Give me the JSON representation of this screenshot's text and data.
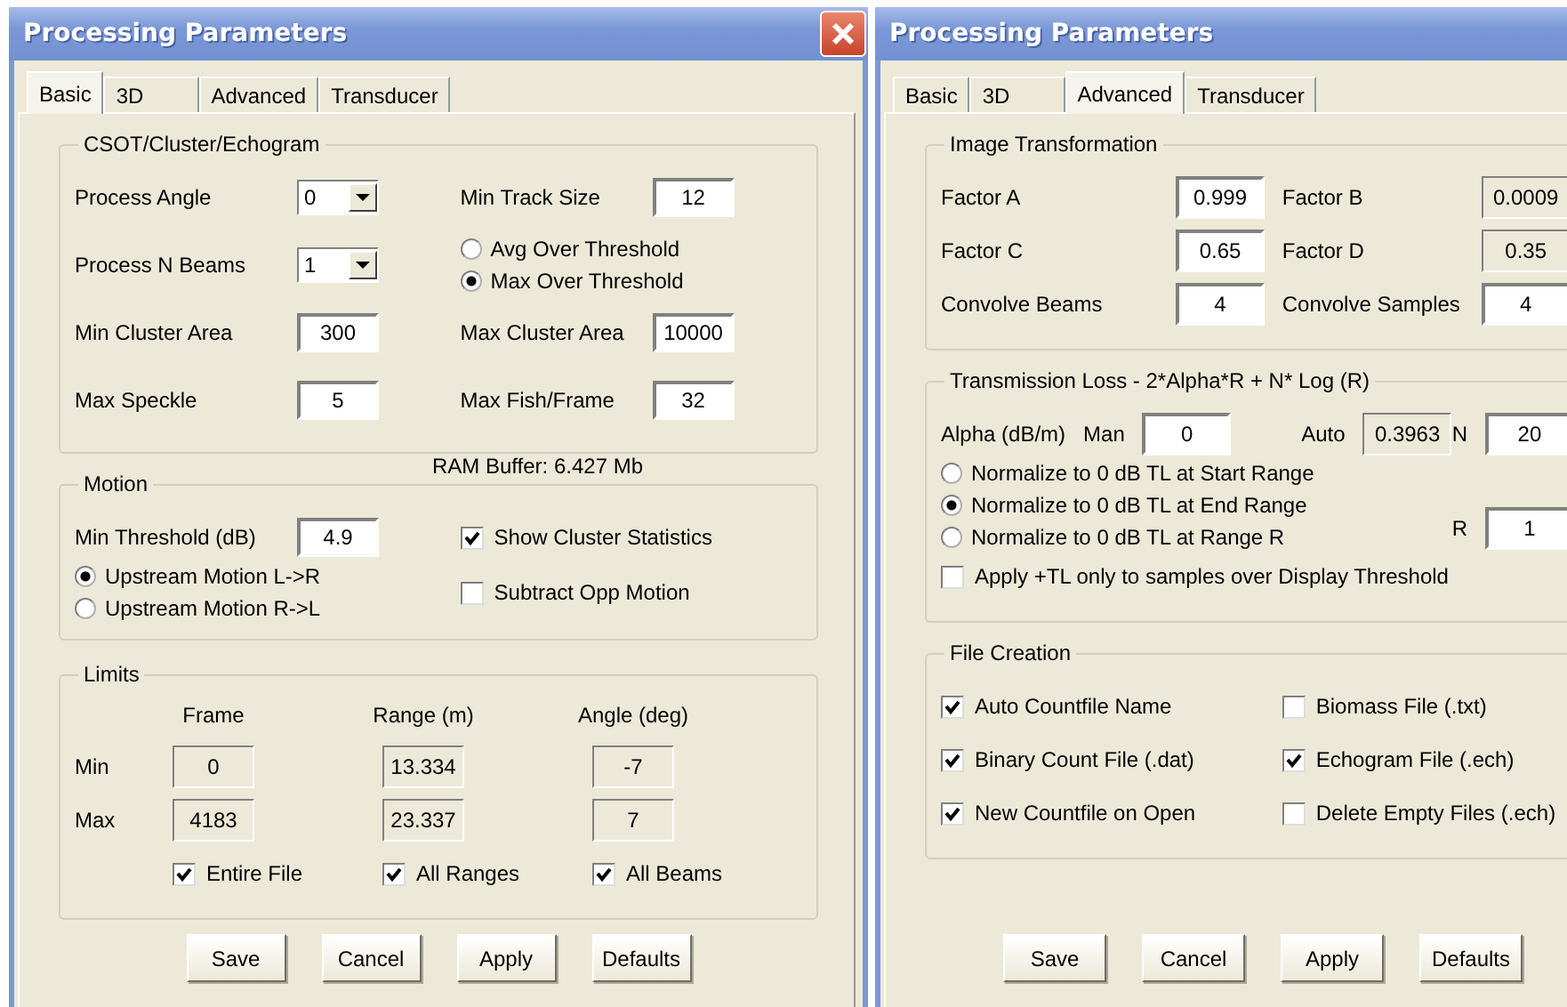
{
  "dialogs": [
    {
      "title": "Processing Parameters",
      "tabs": [
        {
          "label": "Basic",
          "selected": true
        },
        {
          "label": "3D",
          "selected": false
        },
        {
          "label": "Advanced",
          "selected": false
        },
        {
          "label": "Transducer",
          "selected": false
        }
      ],
      "groups": [
        {
          "kind": "form",
          "legend": "CSOT/Cluster/Echogram",
          "rows": [
            [
              [
                {
                  "kind": "label",
                  "text": "Process Angle"
                },
                {
                  "kind": "combo",
                  "value": "0"
                }
              ],
              [
                {
                  "kind": "label",
                  "text": "Min Track Size"
                },
                {
                  "kind": "field",
                  "value": "12"
                }
              ]
            ],
            [
              [
                {
                  "kind": "label",
                  "text": "Process N Beams"
                },
                {
                  "kind": "combo",
                  "value": "1"
                }
              ],
              [
                {
                  "kind": "radios",
                  "options": [
                    {
                      "label": "Avg Over Threshold",
                      "selected": false
                    },
                    {
                      "label": "Max Over Threshold",
                      "selected": true
                    }
                  ]
                }
              ]
            ],
            [
              [
                {
                  "kind": "label",
                  "text": "Min Cluster Area"
                },
                {
                  "kind": "field",
                  "value": "300"
                }
              ],
              [
                {
                  "kind": "label",
                  "text": "Max Cluster Area"
                },
                {
                  "kind": "field",
                  "value": "10000"
                }
              ]
            ],
            [
              [
                {
                  "kind": "label",
                  "text": "Max Speckle"
                },
                {
                  "kind": "field",
                  "value": "5"
                }
              ],
              [
                {
                  "kind": "label",
                  "text": "Max Fish/Frame"
                },
                {
                  "kind": "field",
                  "value": "32"
                }
              ]
            ]
          ],
          "note": "RAM Buffer: 6.427 Mb"
        },
        {
          "kind": "form",
          "legend": "Motion",
          "rows": [
            [
              [
                {
                  "kind": "label",
                  "text": "Min Threshold (dB)"
                },
                {
                  "kind": "field",
                  "value": "4.9"
                }
              ],
              [
                {
                  "kind": "check",
                  "label": "Show Cluster Statistics",
                  "checked": true
                }
              ]
            ],
            [
              [
                {
                  "kind": "radios",
                  "options": [
                    {
                      "label": "Upstream Motion L->R",
                      "selected": true
                    },
                    {
                      "label": "Upstream Motion R->L",
                      "selected": false
                    }
                  ]
                }
              ],
              [
                {
                  "kind": "check",
                  "label": "Subtract Opp Motion",
                  "checked": false
                }
              ]
            ]
          ]
        },
        {
          "kind": "table",
          "legend": "Limits",
          "columns": [
            "Frame",
            "Range (m)",
            "Angle (deg)"
          ],
          "rows": [
            {
              "label": "Min",
              "values": [
                "0",
                "13.334",
                "-7"
              ]
            },
            {
              "label": "Max",
              "values": [
                "4183",
                "23.337",
                "7"
              ]
            }
          ],
          "checks": [
            {
              "label": "Entire File",
              "checked": true
            },
            {
              "label": "All Ranges",
              "checked": true
            },
            {
              "label": "All Beams",
              "checked": true
            }
          ]
        }
      ],
      "buttons": [
        "Save",
        "Cancel",
        "Apply",
        "Defaults"
      ]
    },
    {
      "title": "Processing Parameters",
      "tabs": [
        {
          "label": "Basic",
          "selected": false
        },
        {
          "label": "3D",
          "selected": false
        },
        {
          "label": "Advanced",
          "selected": true
        },
        {
          "label": "Transducer",
          "selected": false
        }
      ],
      "groups": [
        {
          "kind": "form",
          "legend": "Image Transformation",
          "rows": [
            [
              [
                {
                  "kind": "label",
                  "text": "Factor A"
                },
                {
                  "kind": "field",
                  "value": "0.999"
                }
              ],
              [
                {
                  "kind": "label",
                  "text": "Factor B"
                },
                {
                  "kind": "readonly",
                  "value": "0.0009"
                }
              ]
            ],
            [
              [
                {
                  "kind": "label",
                  "text": "Factor C"
                },
                {
                  "kind": "field",
                  "value": "0.65"
                }
              ],
              [
                {
                  "kind": "label",
                  "text": "Factor D"
                },
                {
                  "kind": "readonly",
                  "value": "0.35"
                }
              ]
            ],
            [
              [
                {
                  "kind": "label",
                  "text": "Convolve Beams"
                },
                {
                  "kind": "field",
                  "value": "4"
                }
              ],
              [
                {
                  "kind": "label",
                  "text": "Convolve Samples"
                },
                {
                  "kind": "field",
                  "value": "4"
                }
              ]
            ]
          ]
        },
        {
          "kind": "form",
          "legend": "Transmission Loss  -  2*Alpha*R + N* Log (R)",
          "rows": [
            [
              [
                {
                  "kind": "text",
                  "text": "Alpha (dB/m)"
                },
                {
                  "kind": "text",
                  "text": "Man"
                },
                {
                  "kind": "field",
                  "value": "0"
                }
              ],
              [
                {
                  "kind": "text",
                  "text": "Auto"
                },
                {
                  "kind": "readonly",
                  "value": "0.3963"
                },
                {
                  "kind": "text",
                  "text": "N"
                },
                {
                  "kind": "field",
                  "value": "20"
                }
              ]
            ],
            [
              [
                {
                  "kind": "radios",
                  "options": [
                    {
                      "label": "Normalize to 0 dB TL at Start Range",
                      "selected": false
                    },
                    {
                      "label": "Normalize to 0 dB TL at End Range",
                      "selected": true
                    },
                    {
                      "label": "Normalize to 0 dB TL at Range R",
                      "selected": false
                    }
                  ]
                }
              ],
              [
                {
                  "kind": "text",
                  "text": "R"
                },
                {
                  "kind": "field",
                  "value": "1"
                }
              ]
            ],
            [
              [
                {
                  "kind": "check",
                  "label": "Apply +TL only to samples over Display Threshold",
                  "checked": false
                }
              ]
            ]
          ]
        },
        {
          "kind": "form",
          "legend": "File Creation",
          "rows": [
            [
              [
                {
                  "kind": "check",
                  "label": "Auto Countfile Name",
                  "checked": true
                }
              ],
              [
                {
                  "kind": "check",
                  "label": "Biomass File (.txt)",
                  "checked": false
                }
              ]
            ],
            [
              [
                {
                  "kind": "check",
                  "label": "Binary Count File (.dat)",
                  "checked": true
                }
              ],
              [
                {
                  "kind": "check",
                  "label": "Echogram File (.ech)",
                  "checked": true
                }
              ]
            ],
            [
              [
                {
                  "kind": "check",
                  "label": "New Countfile on Open",
                  "checked": true
                }
              ],
              [
                {
                  "kind": "check",
                  "label": "Delete Empty Files (.ech)",
                  "checked": false
                }
              ]
            ]
          ]
        }
      ],
      "buttons": [
        "Save",
        "Cancel",
        "Apply",
        "Defaults"
      ]
    }
  ]
}
